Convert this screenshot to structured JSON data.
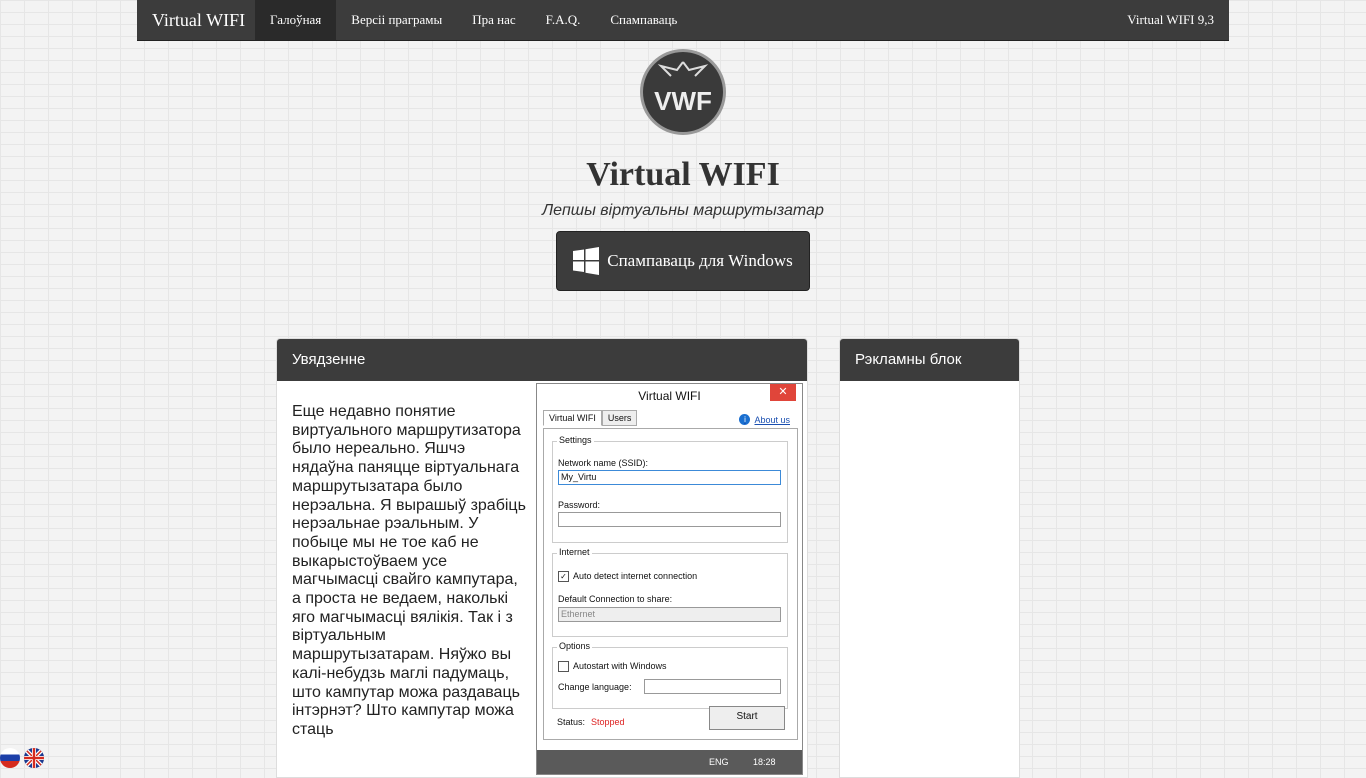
{
  "navbar": {
    "brand": "Virtual WIFI",
    "items": [
      {
        "label": "Галоўная",
        "active": true
      },
      {
        "label": "Версіі праграмы",
        "active": false
      },
      {
        "label": "Пра нас",
        "active": false
      },
      {
        "label": "F.A.Q.",
        "active": false
      },
      {
        "label": "Спампаваць",
        "active": false
      }
    ],
    "version": "Virtual WIFI 9,3"
  },
  "header": {
    "logo_text": "VWF",
    "title": "Virtual WIFI",
    "subtitle": "Лепшы віртуальны маршрутызатар",
    "download_label": "Спампаваць для Windows"
  },
  "main_panel": {
    "heading": "Увядзенне",
    "text": "Еще недавно понятие виртуального маршрутизатора было нереально. Яшчэ нядаўна паняцце віртуальнага маршрутызатара было нерэальна. Я вырашыў зрабіць нерэальнае рэальным. У побыце мы не тое каб не выкарыстоўваем усе магчымасці свайго кампутара, а проста не ведаем, наколькі яго магчымасці вялікія. Так і з віртуальным маршрутызатарам. Няўжо вы калі-небудзь маглі падумаць, што кампутар можа раздаваць інтэрнэт? Што кампутар можа стаць"
  },
  "ad_panel": {
    "heading": "Рэкламны блок"
  },
  "app_screenshot": {
    "title": "Virtual WIFI",
    "close": "✕",
    "tabs": [
      "Virtual WIFI",
      "Users"
    ],
    "about": "About us",
    "settings_label": "Settings",
    "ssid_label": "Network name (SSID):",
    "ssid_value": "My_Virtu",
    "password_label": "Password:",
    "internet_label": "Internet",
    "auto_detect": "Auto detect internet connection",
    "default_conn_label": "Default Connection to share:",
    "default_conn_value": "Ethernet",
    "options_label": "Options",
    "autostart": "Autostart with Windows",
    "change_language": "Change language:",
    "status_label": "Status:",
    "status_value": "Stopped",
    "start": "Start",
    "taskbar_lang": "ENG",
    "taskbar_time": "18:28"
  },
  "colors": {
    "navbar_bg": "#3c3c3c",
    "status_stopped": "#d22222"
  }
}
